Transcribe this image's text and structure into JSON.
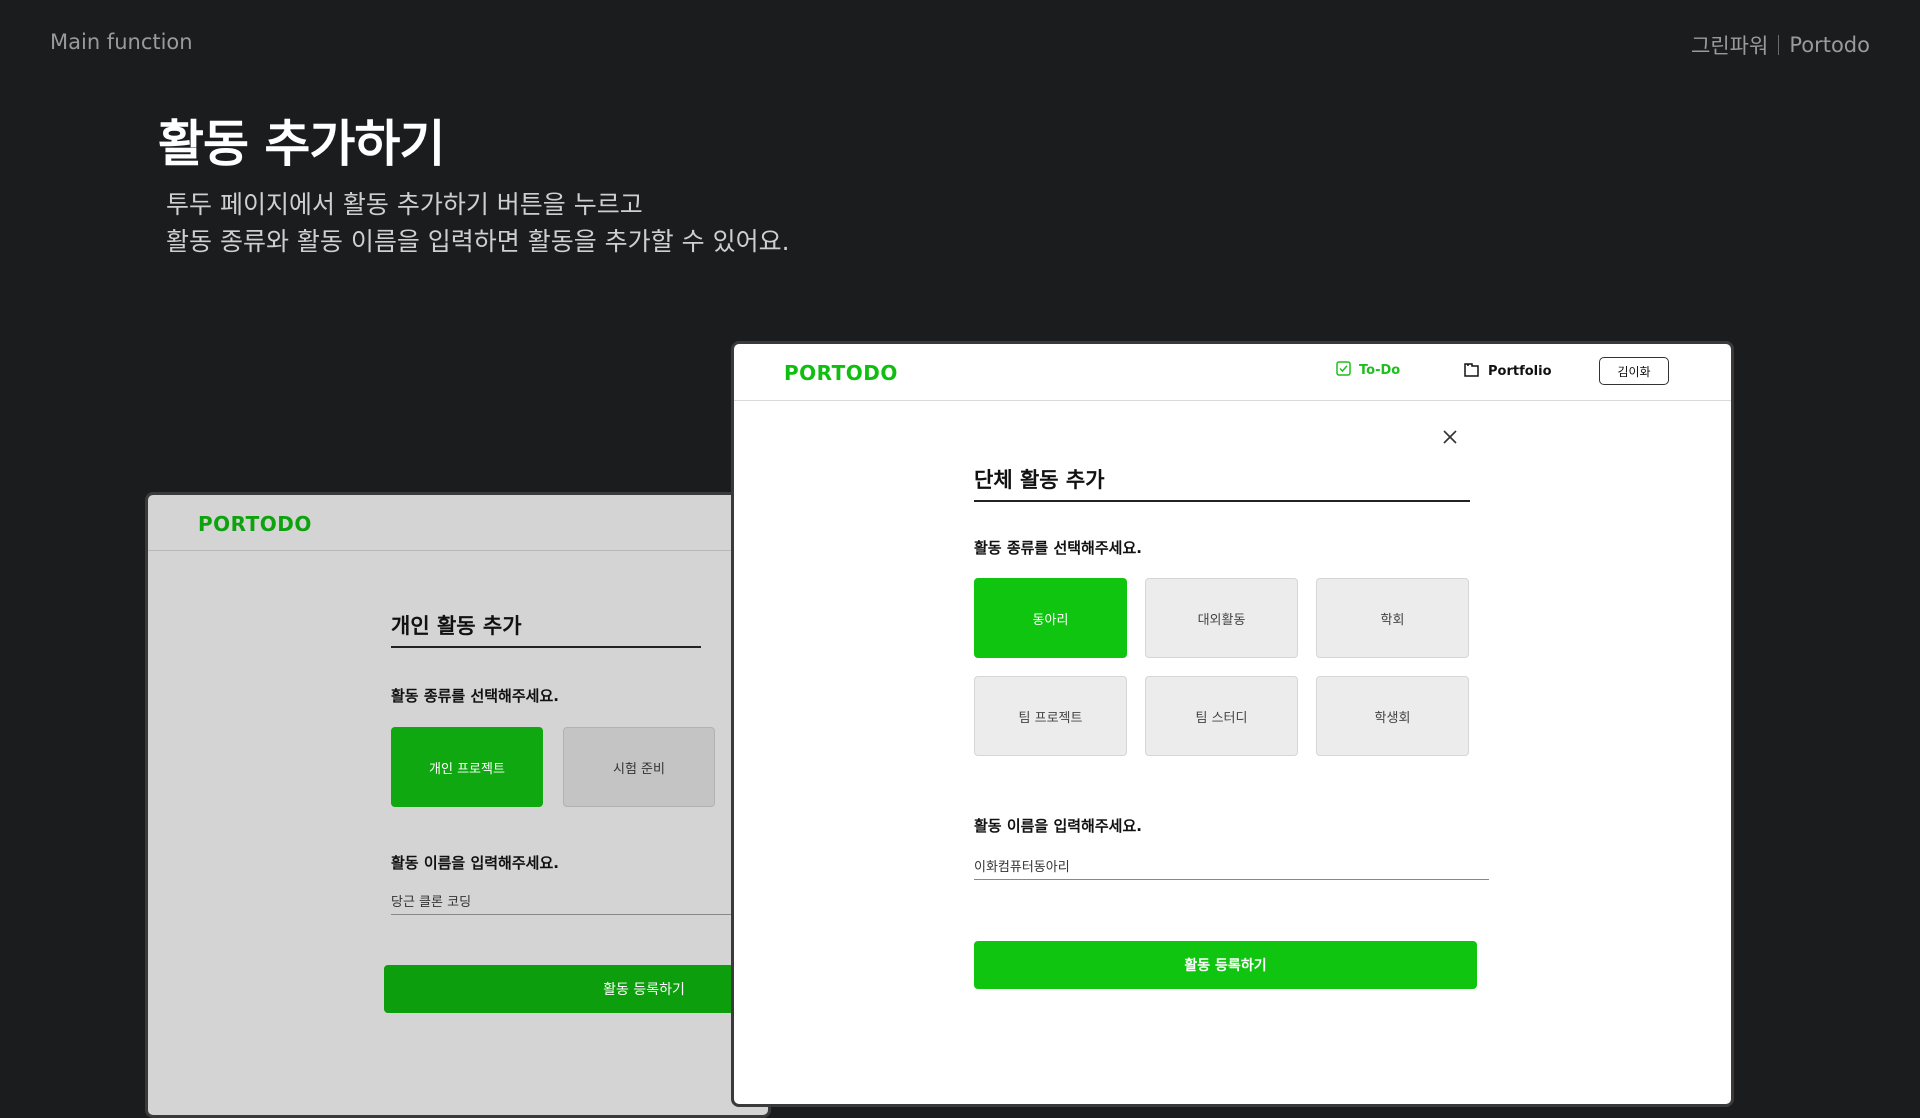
{
  "header": {
    "section": "Main function",
    "brand_team": "그린파워",
    "brand_product": "Portodo"
  },
  "hero": {
    "title": "활동 추가하기",
    "description_line1": "투두 페이지에서 활동 추가하기 버튼을 누르고",
    "description_line2": "활동 종류와 활동 이름을 입력하면 활동을 추가할 수 있어요."
  },
  "personal_window": {
    "logo": "PORTODO",
    "title": "개인 활동 추가",
    "type_prompt": "활동 종류를 선택해주세요.",
    "options": [
      {
        "label": "개인 프로젝트",
        "selected": true
      },
      {
        "label": "시험 준비",
        "selected": false
      }
    ],
    "name_prompt": "활동 이름을 입력해주세요.",
    "name_value": "당근 클론 코딩",
    "submit_label": "활동 등록하기"
  },
  "group_window": {
    "logo": "PORTODO",
    "nav": {
      "todo_label": "To-Do",
      "portfolio_label": "Portfolio",
      "user_label": "김이화"
    },
    "title": "단체 활동 추가",
    "type_prompt": "활동 종류를 선택해주세요.",
    "options": [
      {
        "label": "동아리",
        "selected": true
      },
      {
        "label": "대외활동",
        "selected": false
      },
      {
        "label": "학회",
        "selected": false
      },
      {
        "label": "팀 프로젝트",
        "selected": false
      },
      {
        "label": "팀 스터디",
        "selected": false
      },
      {
        "label": "학생회",
        "selected": false
      }
    ],
    "name_prompt": "활동 이름을 입력해주세요.",
    "name_value": "이화컴퓨터동아리",
    "submit_label": "활동 등록하기"
  },
  "icons": {
    "todo": "checkbox-icon",
    "portfolio": "folder-icon",
    "close": "close-icon"
  },
  "colors": {
    "background": "#1b1c1e",
    "accent_green": "#0fc50f",
    "dim_green": "#0d9e0d"
  }
}
